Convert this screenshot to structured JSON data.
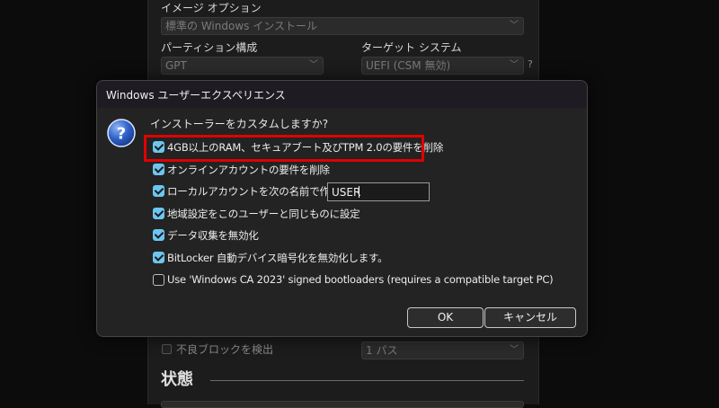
{
  "background_app": {
    "image_option_label": "イメージ オプション",
    "image_option_value": "標準の Windows インストール",
    "partition_label": "パーティション構成",
    "partition_value": "GPT",
    "target_system_label": "ターゲット システム",
    "target_system_value": "UEFI (CSM 無効)",
    "target_help": "?",
    "bad_blocks_label": "不良ブロックを検出",
    "passes_value": "1 パス",
    "status_heading": "状態"
  },
  "dialog": {
    "title": "Windows ユーザーエクスペリエンス",
    "question": "インストーラーをカスタムしますか?",
    "options": [
      {
        "label": "4GB以上のRAM、セキュアブート及びTPM 2.0の要件を削除",
        "checked": true
      },
      {
        "label": "オンラインアカウントの要件を削除",
        "checked": true
      },
      {
        "label": "ローカルアカウントを次の名前で作成:",
        "checked": true
      },
      {
        "label": "地域設定をこのユーザーと同じものに設定",
        "checked": true
      },
      {
        "label": "データ収集を無効化",
        "checked": true
      },
      {
        "label": "BitLocker 自動デバイス暗号化を無効化します。",
        "checked": true
      },
      {
        "label": "Use 'Windows CA 2023' signed bootloaders (requires a compatible target PC)",
        "checked": false
      }
    ],
    "username_value": "USER",
    "ok_label": "OK",
    "cancel_label": "キャンセル",
    "accent_color": "#6cc6f0",
    "highlight_color": "#e00000",
    "icon": "question-icon"
  }
}
